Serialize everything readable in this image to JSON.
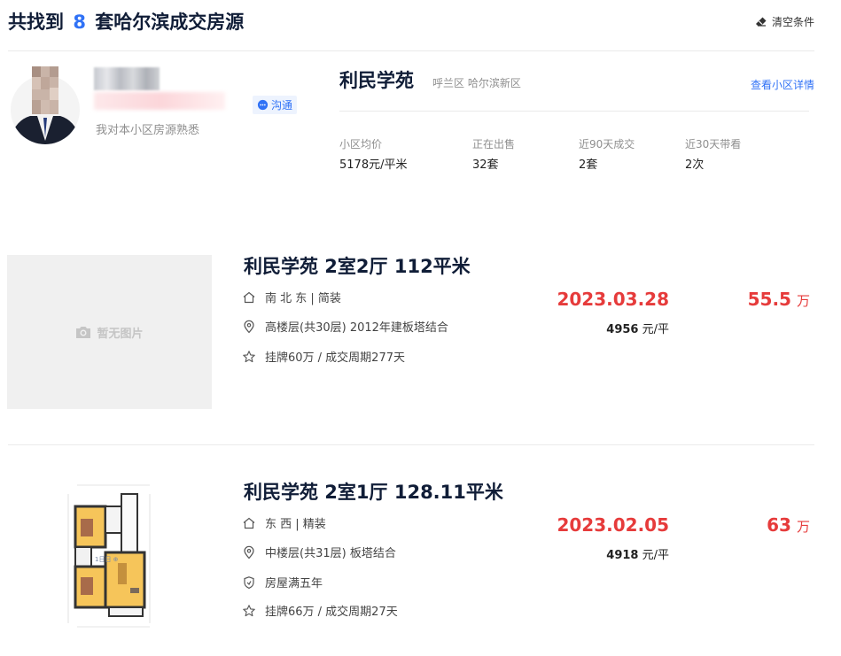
{
  "header": {
    "prefix": "共找到",
    "count": "8",
    "suffix": "套哈尔滨成交房源",
    "clear_label": "清空条件"
  },
  "agent": {
    "desc": "我对本小区房源熟悉",
    "chat_label": "沟通"
  },
  "community": {
    "name": "利民学苑",
    "district": "呼兰区 哈尔滨新区",
    "detail_link": "查看小区详情",
    "stats": [
      {
        "label": "小区均价",
        "value": "5178元/平米"
      },
      {
        "label": "正在出售",
        "value": "32套"
      },
      {
        "label": "近90天成交",
        "value": "2套"
      },
      {
        "label": "近30天带看",
        "value": "2次"
      }
    ]
  },
  "listings": [
    {
      "no_image_label": "暂无图片",
      "title": "利民学苑 2室2厅 112平米",
      "house_info": "南 北 东 | 简装",
      "position_info": "高楼层(共30层) 2012年建板塔结合",
      "deal_cycle": "挂牌60万 / 成交周期277天",
      "deal_date": "2023.03.28",
      "unit_price": "4956",
      "unit_price_suffix": "元/平",
      "total_price": "55.5",
      "total_unit": "万"
    },
    {
      "title": "利民学苑 2室1厅 128.11平米",
      "house_info": "东 西 | 精装",
      "position_info": "中楼层(共31层) 板塔结合",
      "tag": "房屋满五年",
      "deal_cycle": "挂牌66万 / 成交周期27天",
      "deal_date": "2023.02.05",
      "unit_price": "4918",
      "unit_price_suffix": "元/平",
      "total_price": "63",
      "total_unit": "万"
    }
  ],
  "colors": {
    "accent_blue": "#3072f6",
    "price_red": "#e63b3b",
    "title_dark": "#101d37"
  },
  "icons": [
    "eraser-icon",
    "chat-bubble-icon",
    "home-icon",
    "location-pin-icon",
    "shield-icon",
    "star-icon",
    "camera-icon"
  ]
}
